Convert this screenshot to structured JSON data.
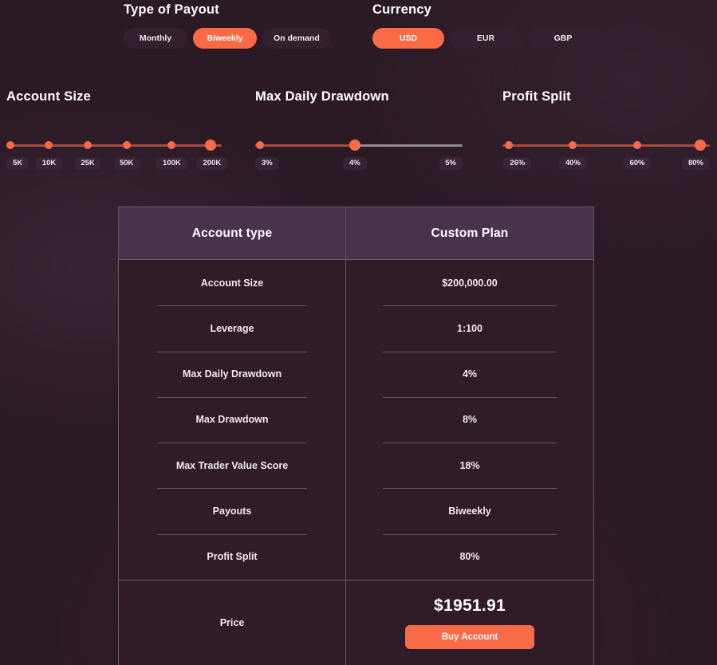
{
  "controls": {
    "payout": {
      "title": "Type of Payout",
      "options": [
        {
          "label": "Monthly",
          "active": false
        },
        {
          "label": "Biweekly",
          "active": true
        },
        {
          "label": "On demand",
          "active": false
        }
      ]
    },
    "currency": {
      "title": "Currency",
      "options": [
        {
          "label": "USD",
          "active": true
        },
        {
          "label": "EUR",
          "active": false
        },
        {
          "label": "GBP",
          "active": false
        }
      ]
    }
  },
  "sliders": [
    {
      "title": "Account Size",
      "ticks": [
        "5K",
        "10K",
        "25K",
        "50K",
        "100K",
        "200K"
      ],
      "selected_index": 5,
      "dots": 6,
      "has_inactive_track": false
    },
    {
      "title": "Max Daily Drawdown",
      "ticks": [
        "3%",
        "4%",
        "5%"
      ],
      "selected_index": 1,
      "dots": 2,
      "has_inactive_track": true
    },
    {
      "title": "Profit Split",
      "ticks": [
        "26%",
        "40%",
        "60%",
        "80%"
      ],
      "selected_index": 3,
      "dots": 4,
      "has_inactive_track": false
    }
  ],
  "table": {
    "headers": [
      "Account type",
      "Custom Plan"
    ],
    "rows": [
      {
        "label": "Account Size",
        "value": "$200,000.00"
      },
      {
        "label": "Leverage",
        "value": "1:100"
      },
      {
        "label": "Max Daily Drawdown",
        "value": "4%"
      },
      {
        "label": "Max Drawdown",
        "value": "8%"
      },
      {
        "label": "Max Trader Value Score",
        "value": "18%"
      },
      {
        "label": "Payouts",
        "value": "Biweekly"
      },
      {
        "label": "Profit Split",
        "value": "80%"
      }
    ],
    "price": {
      "label": "Price",
      "amount": "$1951.91",
      "buy_label": "Buy Account"
    }
  },
  "colors": {
    "accent": "#f96a46",
    "background": "#2a1a26",
    "header_bg": "#47334a",
    "body_bg": "#2f1c28",
    "border": "#6a556a",
    "track_active": "#a84a3c",
    "track_inactive": "#8f8b92"
  }
}
